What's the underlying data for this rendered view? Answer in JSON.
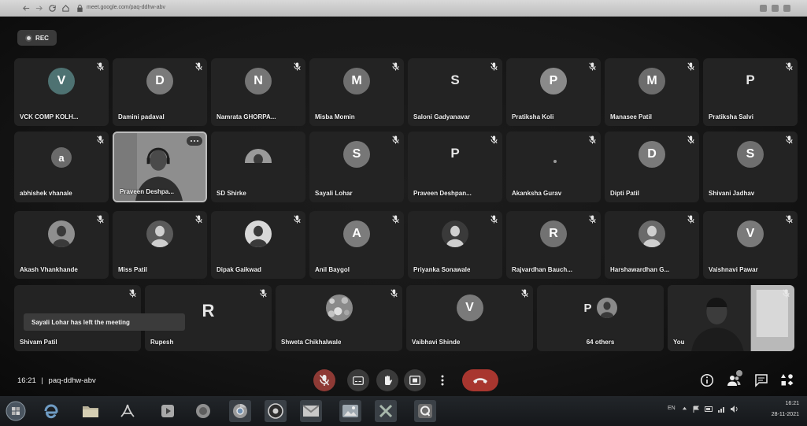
{
  "browser": {
    "url": "meet.google.com/paq-ddhw-abv",
    "nav_icons": [
      "back-icon",
      "forward-icon",
      "reload-icon",
      "home-icon",
      "lock-icon"
    ]
  },
  "recording": {
    "label": "REC"
  },
  "grid": {
    "rows": [
      [
        {
          "name": "VCK COMP KOLH...",
          "avatar": {
            "type": "letter",
            "letter": "V",
            "color": "#4e7272"
          },
          "muted": true
        },
        {
          "name": "Damini padaval",
          "avatar": {
            "type": "letter",
            "letter": "D",
            "color": "#7a7a7a"
          },
          "muted": true
        },
        {
          "name": "Namrata GHORPA...",
          "avatar": {
            "type": "letter",
            "letter": "N",
            "color": "#757575"
          },
          "muted": true
        },
        {
          "name": "Misba Momin",
          "avatar": {
            "type": "letter",
            "letter": "M",
            "color": "#6f6f6f"
          },
          "muted": true
        },
        {
          "name": "Saloni Gadyanavar",
          "avatar": {
            "type": "plain",
            "letter": "S"
          },
          "muted": true
        },
        {
          "name": "Pratiksha Koli",
          "avatar": {
            "type": "letter",
            "letter": "P",
            "color": "#8a8a8a"
          },
          "muted": true
        },
        {
          "name": "Manasee Patil",
          "avatar": {
            "type": "letter",
            "letter": "M",
            "color": "#6c6c6c"
          },
          "muted": true
        },
        {
          "name": "Pratiksha Salvi",
          "avatar": {
            "type": "plain",
            "letter": "P"
          },
          "muted": true
        }
      ],
      [
        {
          "name": "abhishek vhanale",
          "avatar": {
            "type": "letter",
            "letter": "a",
            "color": "#6a6a6a",
            "small": true
          },
          "muted": true
        },
        {
          "name": "Praveen Deshpa...",
          "avatar": {
            "type": "video"
          },
          "active": true,
          "muted": false
        },
        {
          "name": "SD Shirke",
          "avatar": {
            "type": "photo",
            "tone": "#9a9a9a",
            "half": true
          },
          "muted": false
        },
        {
          "name": "Sayali Lohar",
          "avatar": {
            "type": "letter",
            "letter": "S",
            "color": "#777777"
          },
          "muted": true
        },
        {
          "name": "Praveen Deshpan...",
          "avatar": {
            "type": "plain",
            "letter": "P"
          },
          "muted": true
        },
        {
          "name": "Akanksha Gurav",
          "avatar": {
            "type": "dot"
          },
          "muted": true
        },
        {
          "name": "Dipti Patil",
          "avatar": {
            "type": "letter",
            "letter": "D",
            "color": "#7a7a7a"
          },
          "muted": true
        },
        {
          "name": "Shivani Jadhav",
          "avatar": {
            "type": "letter",
            "letter": "S",
            "color": "#6f6f6f"
          },
          "muted": true
        }
      ],
      [
        {
          "name": "Akash Vhankhande",
          "avatar": {
            "type": "photo",
            "tone": "#8f8f8f"
          },
          "muted": true
        },
        {
          "name": "Miss Patil",
          "avatar": {
            "type": "photo",
            "tone": "#5a5a5a"
          },
          "muted": true
        },
        {
          "name": "Dipak Gaikwad",
          "avatar": {
            "type": "photo",
            "tone": "#d8d8d8"
          },
          "muted": true
        },
        {
          "name": "Anil Baygol",
          "avatar": {
            "type": "letter",
            "letter": "A",
            "color": "#7c7c7c"
          },
          "muted": true
        },
        {
          "name": "Priyanka Sonawale",
          "avatar": {
            "type": "photo",
            "tone": "#3a3a3a"
          },
          "muted": true
        },
        {
          "name": "Rajvardhan Bauch...",
          "avatar": {
            "type": "letter",
            "letter": "R",
            "color": "#727272"
          },
          "muted": true
        },
        {
          "name": "Harshawardhan G...",
          "avatar": {
            "type": "photo",
            "tone": "#6a6a6a"
          },
          "muted": true
        },
        {
          "name": "Vaishnavi Pawar",
          "avatar": {
            "type": "letter",
            "letter": "V",
            "color": "#7a7a7a"
          },
          "muted": true
        }
      ],
      [
        {
          "name": "Shivam Patil",
          "avatar": {
            "type": "none"
          },
          "muted": true
        },
        {
          "name": "Rupesh",
          "avatar": {
            "type": "plain",
            "letter": "R",
            "big": true
          },
          "muted": true
        },
        {
          "name": "Shweta Chikhalwale",
          "avatar": {
            "type": "photo",
            "tone": "#8a8a8a",
            "pattern": true
          },
          "muted": true
        },
        {
          "name": "Vaibhavi Shinde",
          "avatar": {
            "type": "letter",
            "letter": "V",
            "color": "#7a7a7a"
          },
          "muted": true
        },
        {
          "name": "64 others",
          "avatar": {
            "type": "group",
            "letter": "P",
            "tone": "#8a8a8a"
          },
          "muted": false,
          "center": true
        },
        {
          "name": "You",
          "avatar": {
            "type": "self-video"
          },
          "muted": true
        }
      ]
    ]
  },
  "toast": {
    "text": "Sayali Lohar has left the meeting"
  },
  "meeting_info": {
    "time": "16:21",
    "separator": "|",
    "code": "paq-ddhw-abv"
  },
  "controls": {
    "center": [
      "mic-off-icon",
      "captions-icon",
      "raise-hand-icon",
      "present-icon",
      "more-options-icon",
      "end-call-icon"
    ],
    "right": [
      "info-icon",
      "people-icon",
      "chat-icon",
      "activities-icon"
    ]
  },
  "colors": {
    "mic_muted": "#8e3a35",
    "end_call": "#a8362f",
    "tile_bg": "#232323"
  },
  "taskbar": {
    "apps": [
      "start-orb-icon",
      "ie-icon",
      "folder-icon",
      "acrobat-icon",
      "media-player-icon",
      "firefox-icon",
      "chrome-icon",
      "app-circle-icon",
      "gmail-icon",
      "image-viewer-icon",
      "excel-icon",
      "q-app-icon"
    ],
    "tray": {
      "language": "EN",
      "time": "16:21",
      "date": "28-11-2021"
    }
  }
}
